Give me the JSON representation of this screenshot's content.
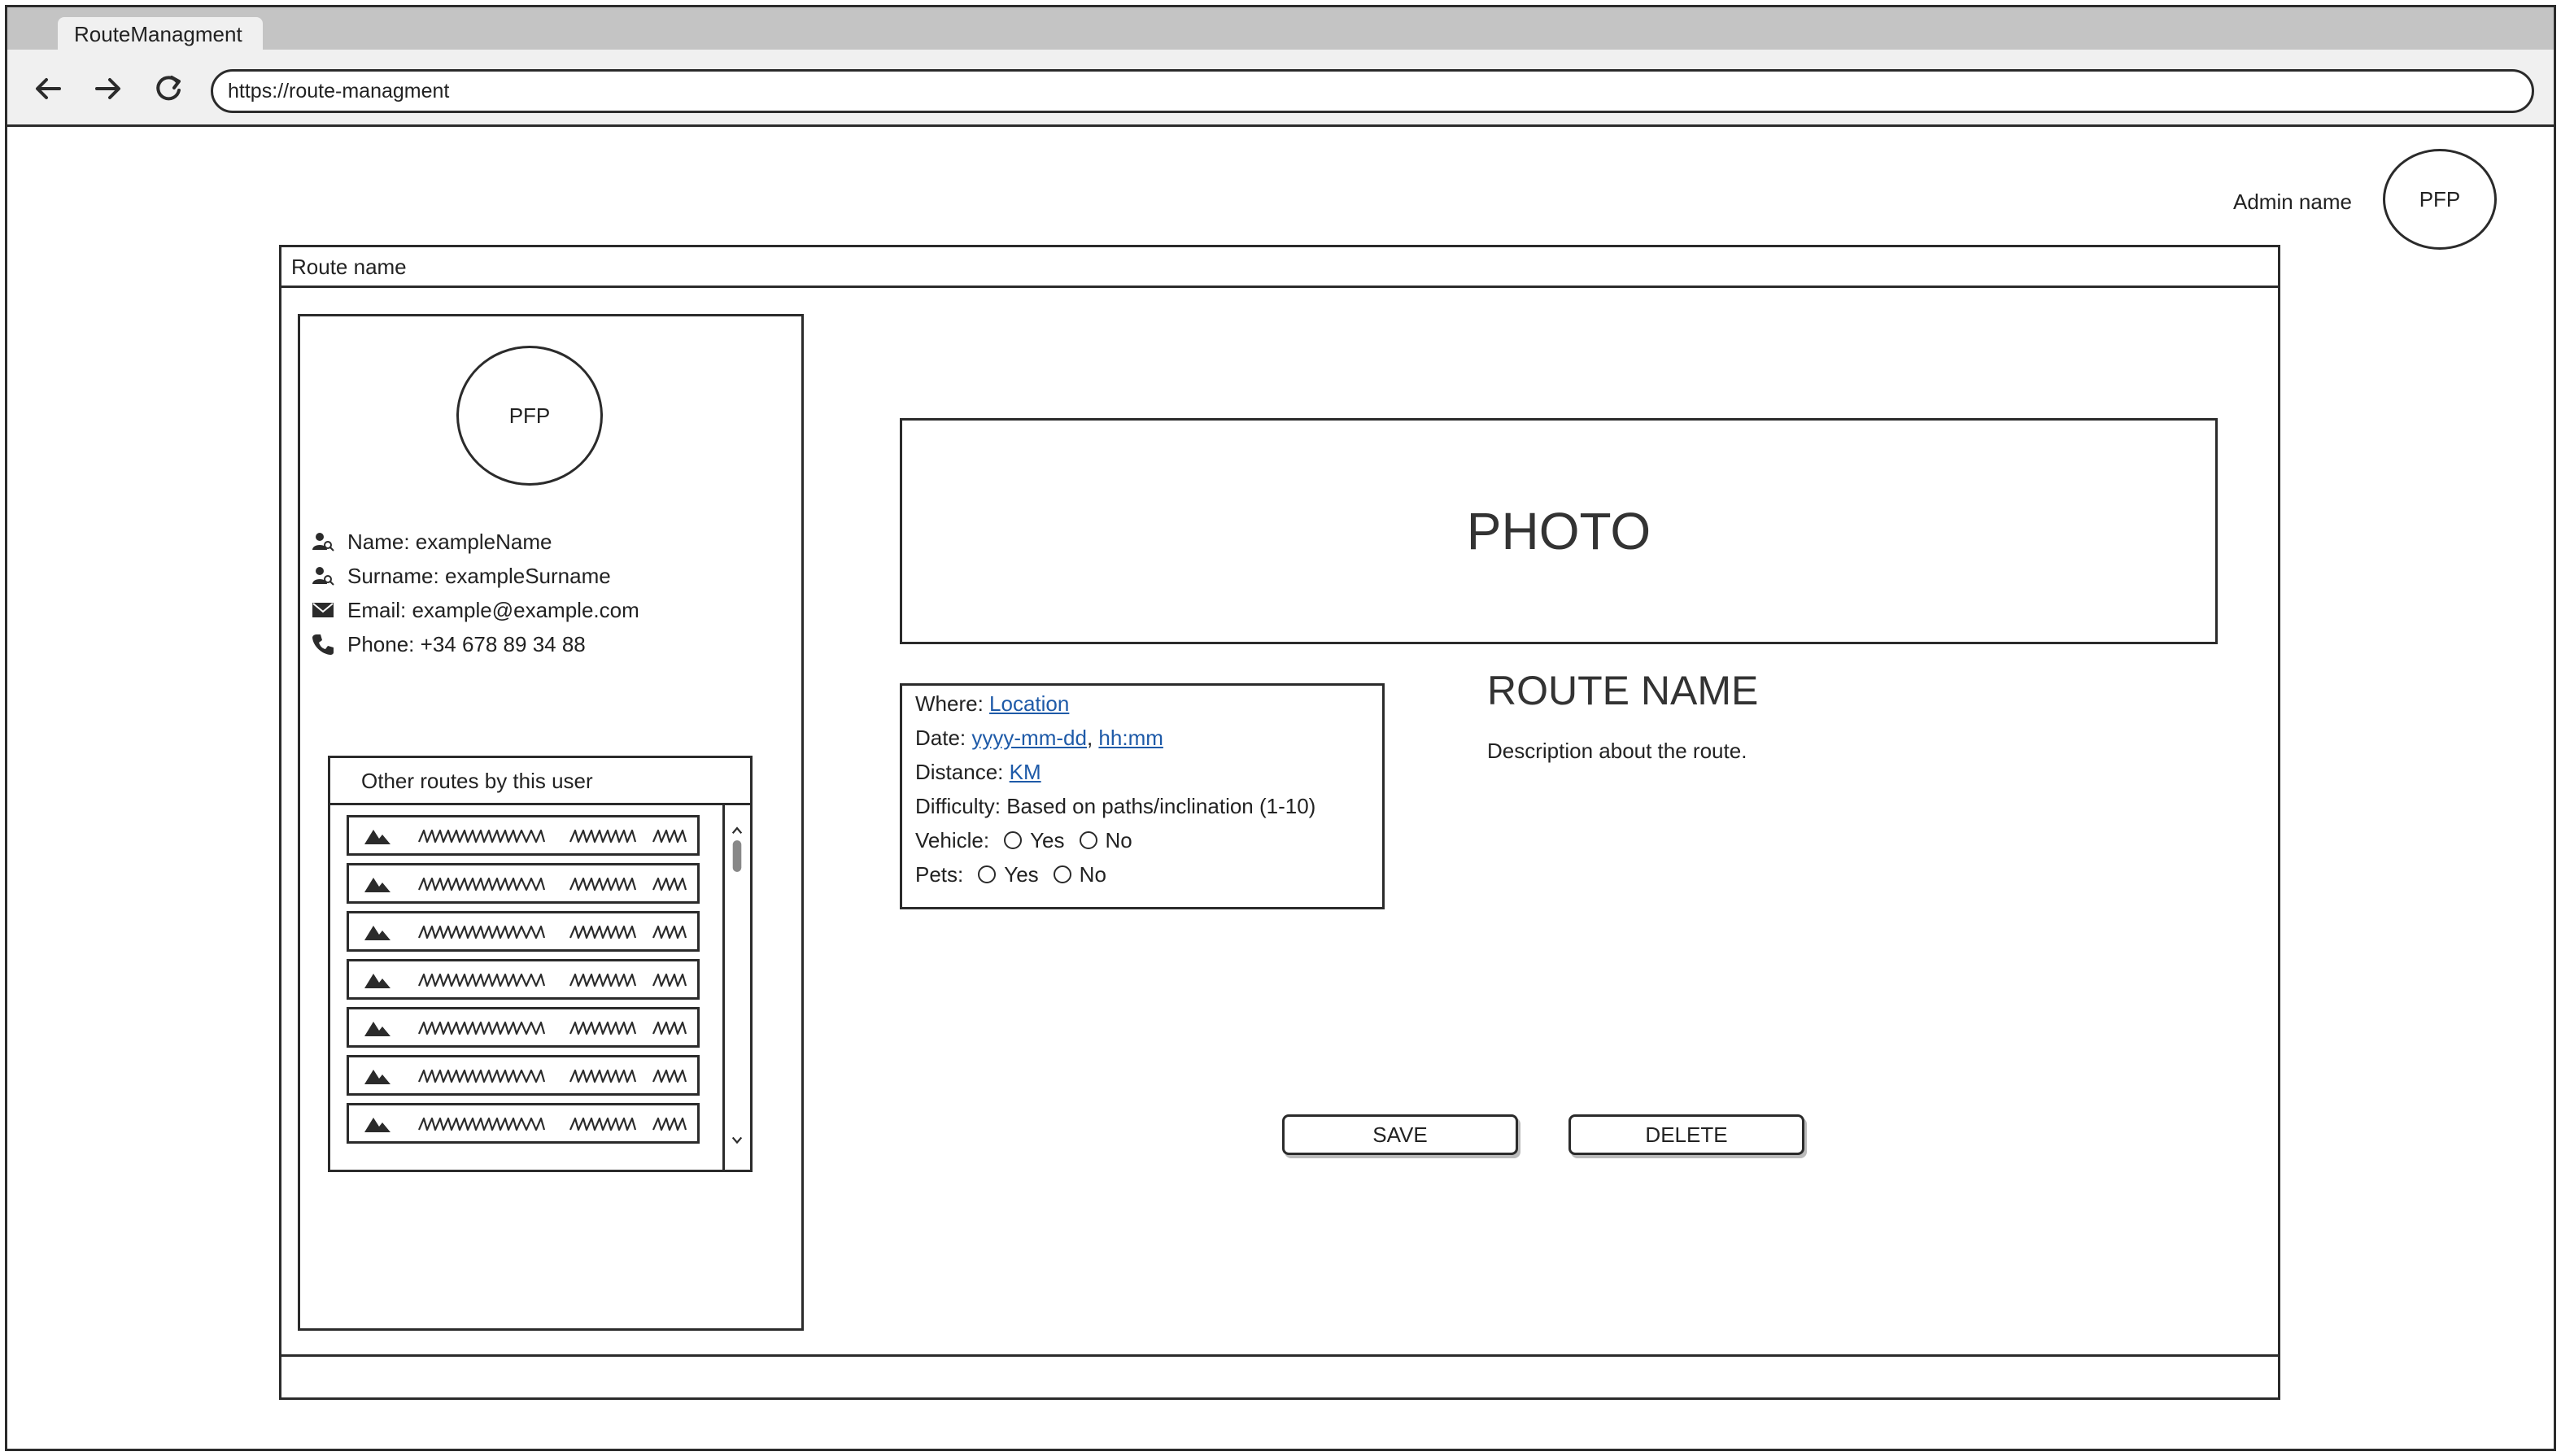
{
  "browser": {
    "tab_title": "RouteManagment",
    "url": "https://route-managment",
    "icons": [
      "back-arrow-icon",
      "forward-arrow-icon",
      "reload-icon"
    ]
  },
  "header": {
    "admin_name": "Admin name",
    "admin_avatar": "PFP"
  },
  "panel": {
    "title": "Route name"
  },
  "user_card": {
    "avatar": "PFP",
    "name": "Name: exampleName",
    "surname": "Surname: exampleSurname",
    "email": "Email: example@example.com",
    "phone": "Phone: +34 678 89 34 88",
    "icons": [
      "user-search-icon",
      "user-search-icon",
      "envelope-icon",
      "phone-icon"
    ]
  },
  "other_routes": {
    "title": "Other routes by this user",
    "item_count_visible": 7,
    "item_icon": "mountain-icon"
  },
  "photo": {
    "label": "PHOTO"
  },
  "details": {
    "where_label": "Where:",
    "where_value": "Location",
    "date_label": "Date:",
    "date_value": "yyyy-mm-dd",
    "date_sep": ",",
    "time_value": "hh:mm",
    "distance_label": "Distance:",
    "distance_value": "KM",
    "difficulty": "Difficulty: Based on paths/inclination (1-10)",
    "vehicle_label": "Vehicle:",
    "pets_label": "Pets:",
    "yes": "Yes",
    "no": "No"
  },
  "route": {
    "name": "ROUTE NAME",
    "description": "Description about the route."
  },
  "actions": {
    "save": "SAVE",
    "delete": "DELETE"
  }
}
